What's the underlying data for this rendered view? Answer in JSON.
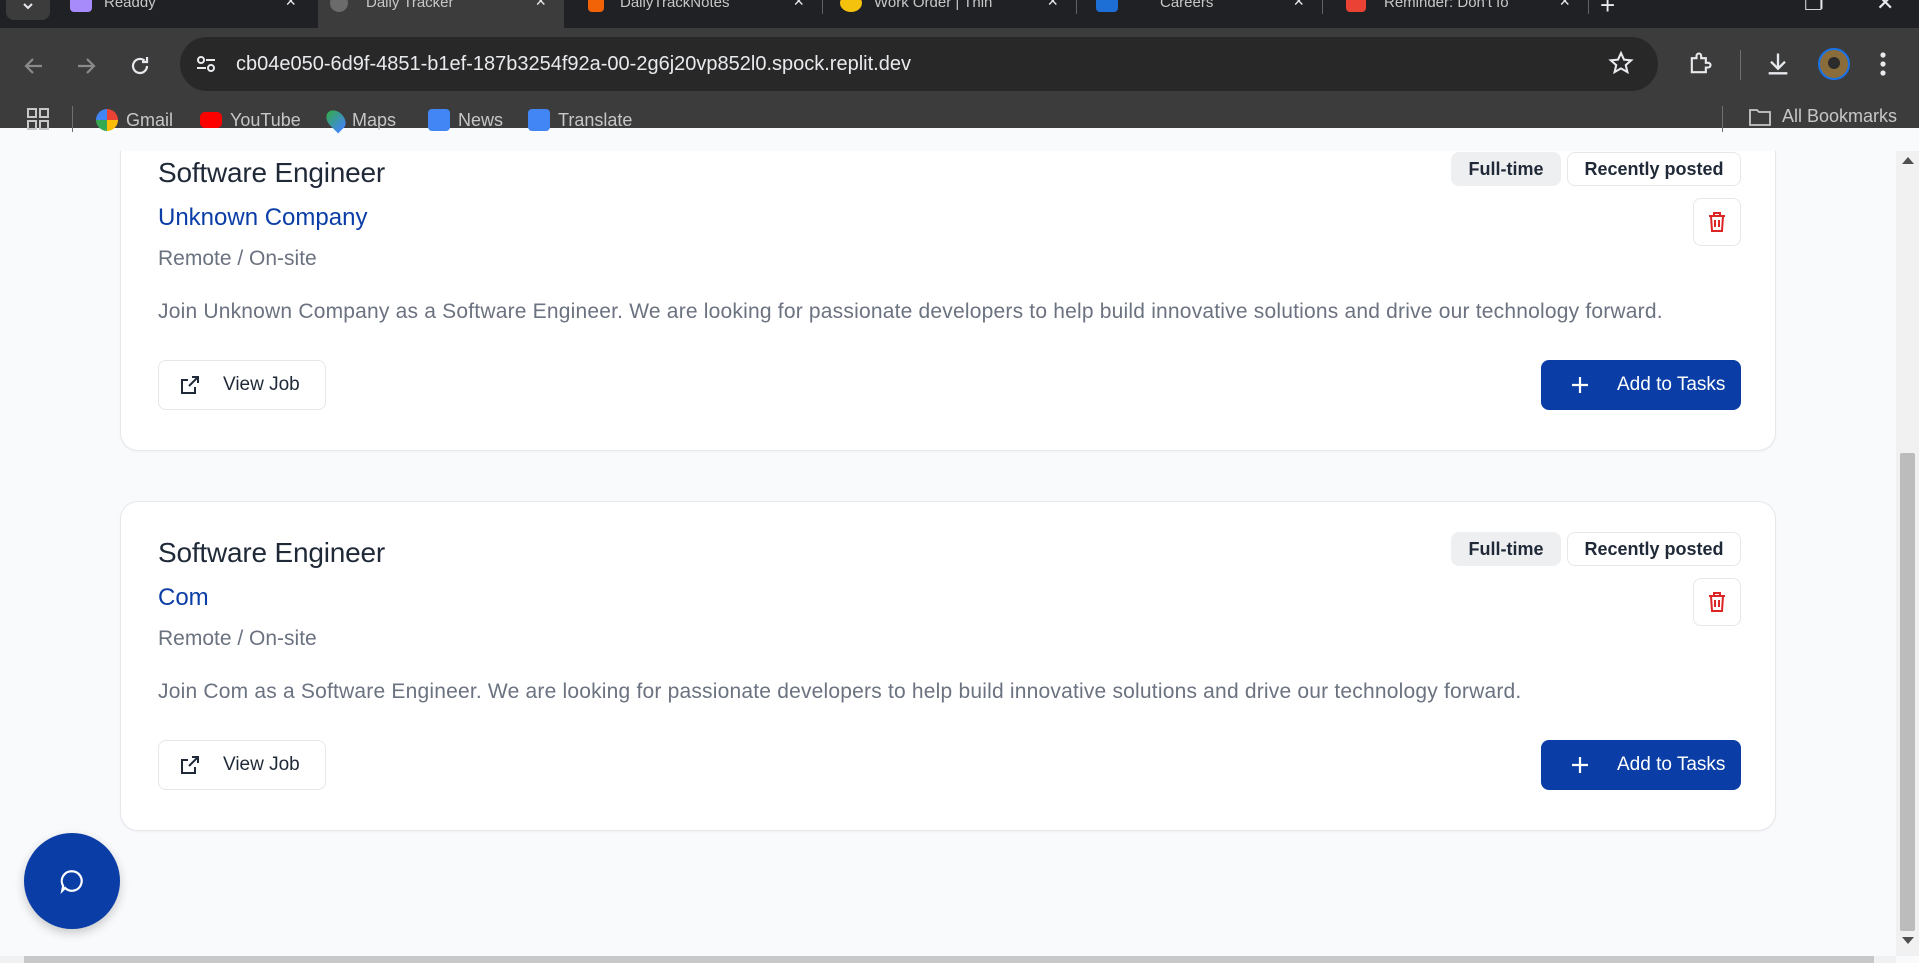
{
  "browser": {
    "tabs": [
      {
        "title": "Readdy",
        "active": false
      },
      {
        "title": "Daily Tracker",
        "active": true
      },
      {
        "title": "DailyTrackNotes",
        "active": false
      },
      {
        "title": "Work Order | Thin",
        "active": false
      },
      {
        "title": "Careers",
        "active": false
      },
      {
        "title": "Reminder: Don't fo",
        "active": false
      }
    ],
    "url": "cb04e050-6d9f-4851-b1ef-187b3254f92a-00-2g6j20vp852l0.spock.replit.dev",
    "bookmarks": [
      "Gmail",
      "YouTube",
      "Maps",
      "News",
      "Translate"
    ],
    "all_bookmarks": "All Bookmarks"
  },
  "jobs": [
    {
      "title": "Software Engineer",
      "company": "Unknown Company",
      "location": "Remote / On-site",
      "description": "Join Unknown Company as a Software Engineer. We are looking for passionate developers to help build innovative solutions and drive our technology forward.",
      "type_badge": "Full-time",
      "posted_badge": "Recently posted",
      "view_label": "View Job",
      "add_label": "Add to Tasks"
    },
    {
      "title": "Software Engineer",
      "company": "Com",
      "location": "Remote / On-site",
      "description": "Join Com as a Software Engineer. We are looking for passionate developers to help build innovative solutions and drive our technology forward.",
      "type_badge": "Full-time",
      "posted_badge": "Recently posted",
      "view_label": "View Job",
      "add_label": "Add to Tasks"
    }
  ],
  "colors": {
    "primary": "#0a3ea6",
    "danger": "#dc2626",
    "muted": "#6b7280"
  }
}
